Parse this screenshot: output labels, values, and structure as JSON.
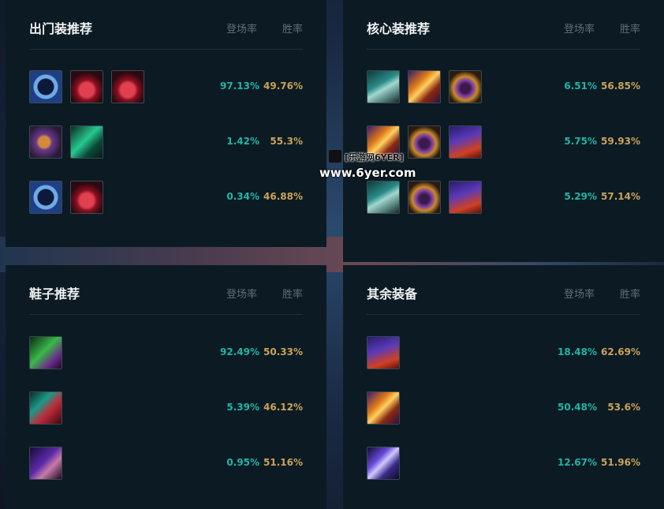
{
  "colors": {
    "panel_bg": "#0c1b23",
    "pick_rate": "#1fb5a8",
    "win_rate": "#c9a25b",
    "header_muted": "#5f6e76"
  },
  "col_pick": "登场率",
  "col_win": "胜率",
  "sections": [
    {
      "title": "出门装推荐",
      "rows": [
        {
          "icons": [
            "ring-item-icon",
            "potion-item-icon",
            "potion-item-icon"
          ],
          "pick": "97.13%",
          "win": "49.76%"
        },
        {
          "icons": [
            "orb-item-icon",
            "crystal-item-icon"
          ],
          "pick": "1.42%",
          "win": "55.3%"
        },
        {
          "icons": [
            "ring-item-icon",
            "potion-item-icon"
          ],
          "pick": "0.34%",
          "win": "46.88%"
        }
      ]
    },
    {
      "title": "核心装推荐",
      "rows": [
        {
          "icons": [
            "gunblade-item-icon",
            "sword-item-icon",
            "mask-item-icon"
          ],
          "pick": "6.51%",
          "win": "56.85%"
        },
        {
          "icons": [
            "sword-item-icon",
            "mask-item-icon",
            "hat-item-icon"
          ],
          "pick": "5.75%",
          "win": "59.93%"
        },
        {
          "icons": [
            "gunblade-item-icon",
            "mask-item-icon",
            "hat-item-icon"
          ],
          "pick": "5.29%",
          "win": "57.14%"
        }
      ]
    },
    {
      "title": "鞋子推荐",
      "rows": [
        {
          "icons": [
            "boots-green-item-icon"
          ],
          "pick": "92.49%",
          "win": "50.33%"
        },
        {
          "icons": [
            "boots-red-item-icon"
          ],
          "pick": "5.39%",
          "win": "46.12%"
        },
        {
          "icons": [
            "boots-purple-item-icon"
          ],
          "pick": "0.95%",
          "win": "51.16%"
        }
      ]
    },
    {
      "title": "其余装备",
      "rows": [
        {
          "icons": [
            "hat-item-icon"
          ],
          "pick": "18.48%",
          "win": "62.69%"
        },
        {
          "icons": [
            "sword-item-icon"
          ],
          "pick": "50.48%",
          "win": "53.6%"
        },
        {
          "icons": [
            "staff-item-icon"
          ],
          "pick": "12.67%",
          "win": "51.96%"
        }
      ]
    }
  ],
  "watermark": {
    "line1": "[乐游网6YER]",
    "line2": "www.6yer.com"
  }
}
